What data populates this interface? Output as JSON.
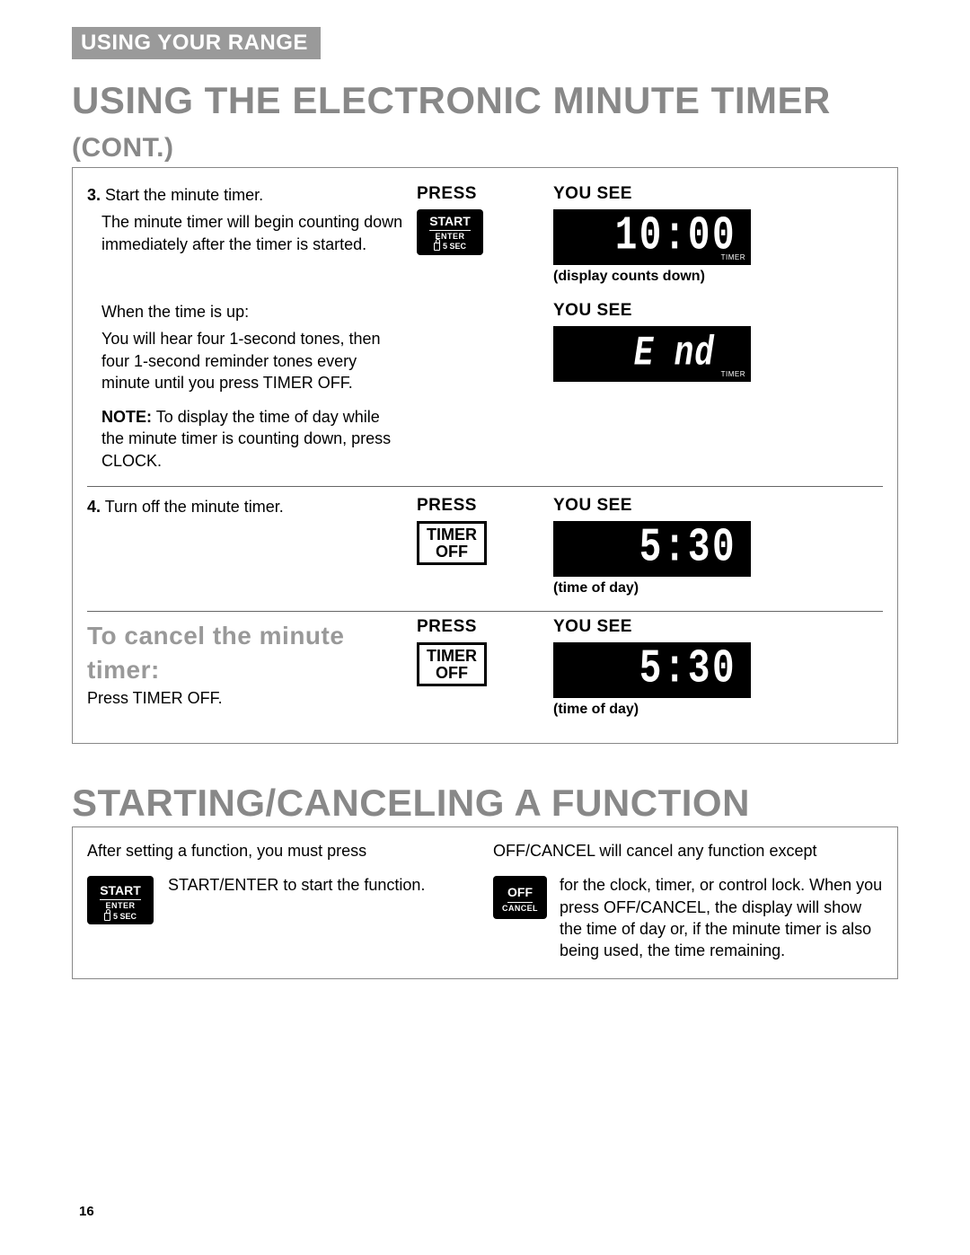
{
  "header": {
    "section_tab": "USING YOUR RANGE"
  },
  "heading1": {
    "main": "USING THE ELECTRONIC MINUTE TIMER",
    "sub": "(CONT.)"
  },
  "heading2": "STARTING/CANCELING A FUNCTION",
  "labels": {
    "press": "PRESS",
    "you_see": "YOU SEE"
  },
  "buttons": {
    "start": {
      "l1": "START",
      "l2": "ENTER",
      "l3": "5 SEC"
    },
    "timer_off": {
      "l1": "TIMER",
      "l2": "OFF"
    },
    "off_cancel": {
      "l1": "OFF",
      "l2": "CANCEL"
    }
  },
  "step3": {
    "num": "3.",
    "title": "Start the minute timer.",
    "desc": "The minute timer will begin counting down immediately after the timer is started.",
    "when_up": "When the time is up:",
    "when_up_desc": "You will hear four 1-second tones, then four 1-second reminder tones every minute until you press TIMER OFF.",
    "note_label": "NOTE:",
    "note_text": "To display the time of day while the minute timer is counting down, press CLOCK.",
    "display1": {
      "value": "10:00",
      "tag": "TIMER",
      "caption": "(display counts down)"
    },
    "display2": {
      "value": "E nd",
      "tag": "TIMER"
    }
  },
  "step4": {
    "num": "4.",
    "title": "Turn off the minute timer.",
    "display": {
      "value": "5:30",
      "caption": "(time of day)"
    }
  },
  "cancel": {
    "heading": "To cancel the minute timer:",
    "text": "Press TIMER OFF.",
    "display": {
      "value": "5:30",
      "caption": "(time of day)"
    }
  },
  "panel2": {
    "left_intro": "After setting a function, you must press",
    "left_rest": "START/ENTER to start the function.",
    "right_intro": "OFF/CANCEL will cancel any function except",
    "right_rest": "for the clock, timer, or control lock. When you press OFF/CANCEL, the display will show the time of day or, if the minute timer is also being used, the time remaining."
  },
  "page_number": "16"
}
